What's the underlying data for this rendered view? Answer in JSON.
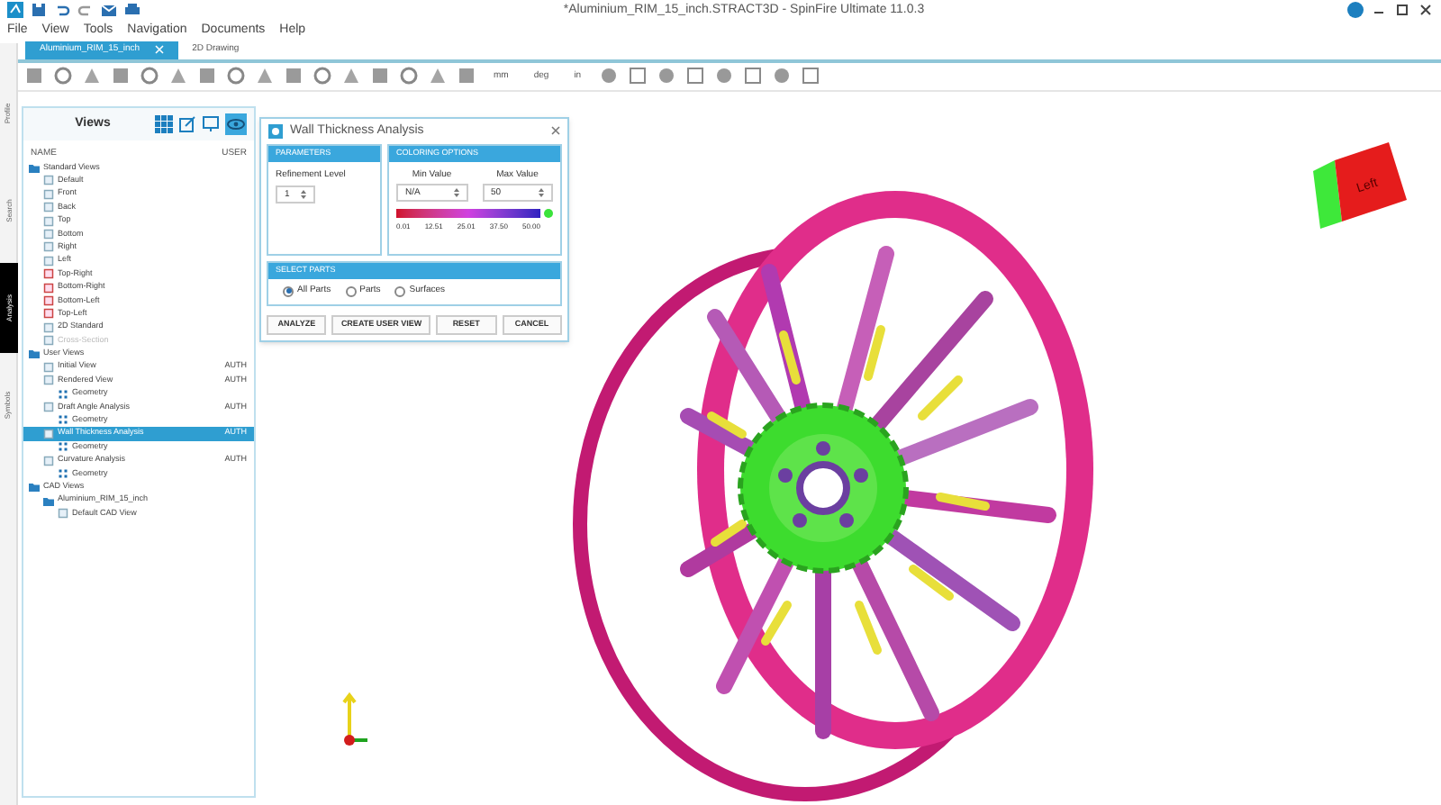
{
  "window": {
    "title": "*Aluminium_RIM_15_inch.STRACT3D - SpinFire Ultimate 11.0.3"
  },
  "menu": [
    "File",
    "View",
    "Tools",
    "Navigation",
    "Documents",
    "Help"
  ],
  "doc_tabs": [
    {
      "label": "Aluminium_RIM_15_inch",
      "selected": true
    },
    {
      "label": "2D Drawing",
      "selected": false
    }
  ],
  "toolbar_units": [
    "mm",
    "deg",
    "in"
  ],
  "side_tabs": [
    {
      "label": "Profile",
      "selected": false
    },
    {
      "label": "Search",
      "selected": false
    },
    {
      "label": "Analysis",
      "selected": true
    },
    {
      "label": "Symbols",
      "selected": false
    }
  ],
  "views_panel": {
    "title": "Views",
    "columns": [
      "NAME",
      "USER"
    ],
    "tree": [
      {
        "label": "Standard Views",
        "kind": "folder",
        "selected": false,
        "disabled": false,
        "children": [
          {
            "label": "Default",
            "kind": "view",
            "selected": false,
            "disabled": false
          },
          {
            "label": "Front",
            "kind": "view",
            "selected": false,
            "disabled": false
          },
          {
            "label": "Back",
            "kind": "view",
            "selected": false,
            "disabled": false
          },
          {
            "label": "Top",
            "kind": "view",
            "selected": false,
            "disabled": false
          },
          {
            "label": "Bottom",
            "kind": "view",
            "selected": false,
            "disabled": false
          },
          {
            "label": "Right",
            "kind": "view",
            "selected": false,
            "disabled": false
          },
          {
            "label": "Left",
            "kind": "view",
            "selected": false,
            "disabled": false
          },
          {
            "label": "Top-Right",
            "kind": "corner",
            "selected": false,
            "disabled": false
          },
          {
            "label": "Bottom-Right",
            "kind": "corner",
            "selected": false,
            "disabled": false
          },
          {
            "label": "Bottom-Left",
            "kind": "corner",
            "selected": false,
            "disabled": false
          },
          {
            "label": "Top-Left",
            "kind": "corner",
            "selected": false,
            "disabled": false
          },
          {
            "label": "2D Standard",
            "kind": "view",
            "selected": false,
            "disabled": false
          },
          {
            "label": "Cross-Section",
            "kind": "view",
            "selected": false,
            "disabled": true
          }
        ]
      },
      {
        "label": "User Views",
        "kind": "folder",
        "selected": false,
        "disabled": false,
        "children": [
          {
            "label": "Initial View",
            "kind": "view",
            "user": "AUTH",
            "selected": false,
            "disabled": false
          },
          {
            "label": "Rendered View",
            "kind": "view",
            "user": "AUTH",
            "selected": false,
            "disabled": false,
            "children": [
              {
                "label": "Geometry",
                "kind": "geometry",
                "selected": false,
                "disabled": false
              }
            ]
          },
          {
            "label": "Draft Angle Analysis",
            "kind": "view",
            "user": "AUTH",
            "selected": false,
            "disabled": false,
            "children": [
              {
                "label": "Geometry",
                "kind": "geometry",
                "selected": false,
                "disabled": false
              }
            ]
          },
          {
            "label": "Wall Thickness Analysis",
            "kind": "view",
            "user": "AUTH",
            "selected": true,
            "disabled": false,
            "children": [
              {
                "label": "Geometry",
                "kind": "geometry",
                "selected": false,
                "disabled": false
              }
            ]
          },
          {
            "label": "Curvature Analysis",
            "kind": "view",
            "user": "AUTH",
            "selected": false,
            "disabled": false,
            "children": [
              {
                "label": "Geometry",
                "kind": "geometry",
                "selected": false,
                "disabled": false
              }
            ]
          }
        ]
      },
      {
        "label": "CAD Views",
        "kind": "folder",
        "selected": false,
        "disabled": false,
        "children": [
          {
            "label": "Aluminium_RIM_15_inch",
            "kind": "folder",
            "selected": false,
            "disabled": false,
            "children": [
              {
                "label": "Default CAD View",
                "kind": "view",
                "selected": false,
                "disabled": false
              }
            ]
          }
        ]
      }
    ]
  },
  "dialog": {
    "title": "Wall Thickness Analysis",
    "parameters": {
      "heading": "PARAMETERS",
      "label": "Refinement Level",
      "value": "1"
    },
    "coloring": {
      "heading": "COLORING OPTIONS",
      "min_label": "Min Value",
      "min_value": "N/A",
      "max_label": "Max Value",
      "max_value": "50",
      "scale": [
        "0.01",
        "12.51",
        "25.01",
        "37.50",
        "50.00"
      ]
    },
    "select_parts": {
      "heading": "SELECT PARTS",
      "options": [
        {
          "label": "All Parts",
          "selected": true
        },
        {
          "label": "Parts",
          "selected": false
        },
        {
          "label": "Surfaces",
          "selected": false
        }
      ]
    },
    "buttons": [
      "ANALYZE",
      "CREATE USER VIEW",
      "RESET",
      "CANCEL"
    ]
  },
  "view_cube": {
    "face": "Left"
  }
}
